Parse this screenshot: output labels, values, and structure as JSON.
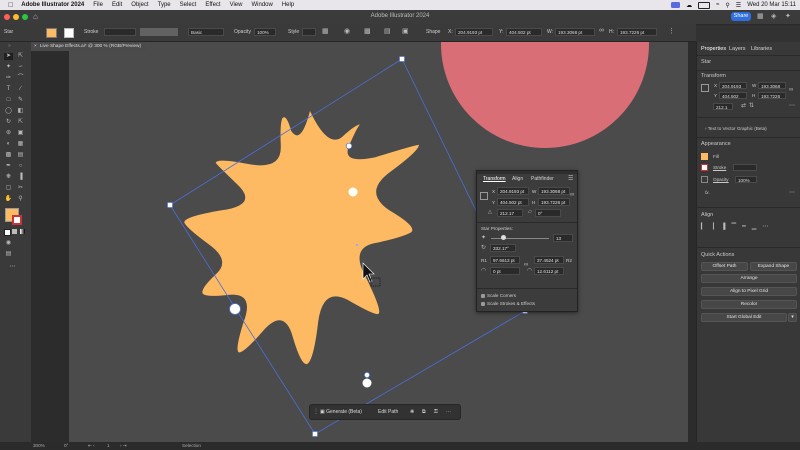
{
  "mac_menubar": {
    "app_name": "Adobe Illustrator 2024",
    "menus": [
      "File",
      "Edit",
      "Object",
      "Type",
      "Select",
      "Effect",
      "View",
      "Window",
      "Help"
    ],
    "datetime": "Wed 20 Mar  15:11"
  },
  "window": {
    "title": "Adobe Illustrator 2024",
    "share_label": "Share"
  },
  "control_bar": {
    "selection_label": "Star",
    "stroke_label": "Stroke",
    "brush_label": "Basic",
    "opacity_label": "Opacity",
    "opacity_value": "100%",
    "style_label": "Style",
    "shape_label": "Shape",
    "x_value": "204.9193 pt",
    "y_value": "404.502 pt",
    "w_value": "193.3068 pt",
    "h_value": "193.7226 pt"
  },
  "doc_tab": {
    "label": "Live Shape Effects.ai* @ 300 % (RGB/Preview)"
  },
  "properties_panel": {
    "tabs": [
      "Properties",
      "Layers",
      "Libraries"
    ],
    "object_type": "Star",
    "transform_header": "Transform",
    "x_label": "X",
    "x_value": "204.9193",
    "y_label": "Y",
    "y_value": "404.502",
    "w_label": "W",
    "w_value": "193.3068",
    "h_label": "H",
    "h_value": "193.7226",
    "angle_value": "212.1",
    "text_to_vector": "Text to Vector Graphic (Beta)",
    "appearance_header": "Appearance",
    "fill_label": "Fill",
    "stroke_label": "Stroke",
    "opacity_label": "Opacity",
    "opacity_value": "100%",
    "fx_label": "fx.",
    "align_header": "Align",
    "quick_actions_header": "Quick Actions",
    "buttons": {
      "offset_path": "Offset Path",
      "expand_shape": "Expand Shape",
      "arrange": "Arrange",
      "align_pixel_grid": "Align to Pixel Grid",
      "recolor": "Recolor",
      "start_global_edit": "Start Global Edit"
    }
  },
  "transform_panel": {
    "tabs": [
      "Transform",
      "Align",
      "Pathfinder"
    ],
    "x_label": "X",
    "x_value": "204.9193 pt",
    "y_label": "Y",
    "y_value": "404.502 pt",
    "w_label": "W",
    "w_value": "193.3068 pt",
    "h_label": "H",
    "h_value": "193.7226 pt",
    "rotation_value": "212.17",
    "shear_value": "0°",
    "star_properties_label": "Star Properties:",
    "points_value": "13",
    "star_angle_value": "332.17°",
    "r1_label": "R1",
    "r1_value": "97.6613 pt",
    "r2_label": "R2",
    "r2_value": "37.4524 pt",
    "corner1_value": "0 pt",
    "corner2_value": "12.6112 pt",
    "scale_corners_label": "Scale Corners",
    "scale_strokes_label": "Scale Strokes & Effects"
  },
  "contextual_bar": {
    "generate_label": "Generate (Beta)",
    "edit_path_label": "Edit Path"
  },
  "status_bar": {
    "zoom": "300%",
    "rotation": "0°",
    "artboard": "1",
    "tool": "Selection"
  },
  "colors": {
    "star_fill": "#FDBA63",
    "circle_fill": "#D96E77",
    "selection_blue": "#4A6FD8",
    "share_blue": "#2F6FDE"
  },
  "icons": [
    "apple-icon",
    "home-icon",
    "wifi-icon",
    "search-icon",
    "cursor-icon",
    "link-icon"
  ]
}
